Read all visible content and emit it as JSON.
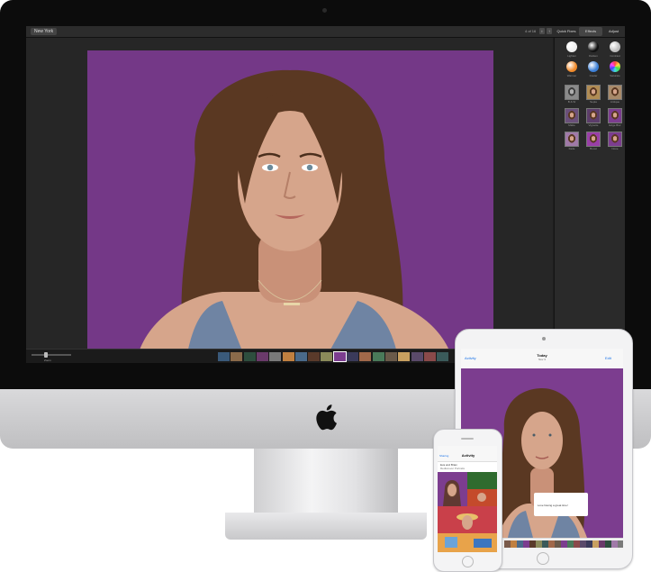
{
  "imac": {
    "app": {
      "album_title": "New York",
      "photo_count": "4 of 16",
      "toolbar_info_glyph": "i",
      "toolbar_share_glyph": "↑",
      "tabs": [
        "Quick Fixes",
        "Effects",
        "Adjust"
      ],
      "active_tab": "Effects",
      "effects_top": [
        "Lighten",
        "Darken",
        "Contrast",
        "Warmer",
        "Cooler",
        "Saturate"
      ],
      "effects_grid": [
        "B & W",
        "Sepia",
        "Antique",
        "Matte",
        "Vignette",
        "Edge Blur",
        "Fade",
        "Boost",
        "None"
      ],
      "zoom_label": "Zoom"
    }
  },
  "ipad": {
    "back_label": "Activity",
    "title": "Today",
    "date": "Nov 3",
    "edit_label": "Edit",
    "caption": "Love having a great time!"
  },
  "iphone": {
    "back_label": "Sharing",
    "title": "Activity",
    "row1": "Eva and Brian",
    "row2": "Rediscover Portraits"
  },
  "colors": {
    "purple_wall": "#7c3d8f",
    "hair": "#5a3822",
    "skin": "#d6a58b",
    "tank_top": "#6f84a3",
    "accent_blue": "#1a73e8"
  }
}
